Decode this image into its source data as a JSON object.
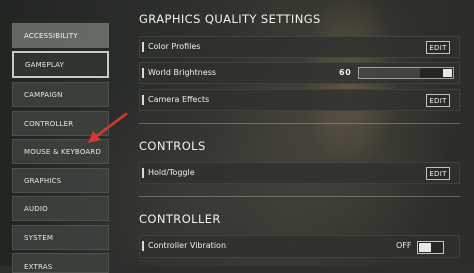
{
  "sidebar": {
    "items": [
      {
        "label": "ACCESSIBILITY"
      },
      {
        "label": "GAMEPLAY"
      },
      {
        "label": "CAMPAIGN"
      },
      {
        "label": "CONTROLLER"
      },
      {
        "label": "MOUSE & KEYBOARD"
      },
      {
        "label": "GRAPHICS"
      },
      {
        "label": "AUDIO"
      },
      {
        "label": "SYSTEM"
      },
      {
        "label": "EXTRAS"
      }
    ]
  },
  "graphics": {
    "title": "GRAPHICS QUALITY SETTINGS",
    "color_profiles": {
      "label": "Color Profiles",
      "button": "EDIT"
    },
    "world_brightness": {
      "label": "World Brightness",
      "value": "60",
      "fraction": 0.6
    },
    "camera_effects": {
      "label": "Camera Effects",
      "button": "EDIT"
    }
  },
  "controls": {
    "title": "CONTROLS",
    "hold_toggle": {
      "label": "Hold/Toggle",
      "button": "EDIT"
    }
  },
  "controller": {
    "title": "CONTROLLER",
    "vibration": {
      "label": "Controller Vibration",
      "state": "OFF"
    }
  },
  "colors": {
    "annotation_arrow": "#d63a2f",
    "selected_border": "#c9ccc4"
  }
}
